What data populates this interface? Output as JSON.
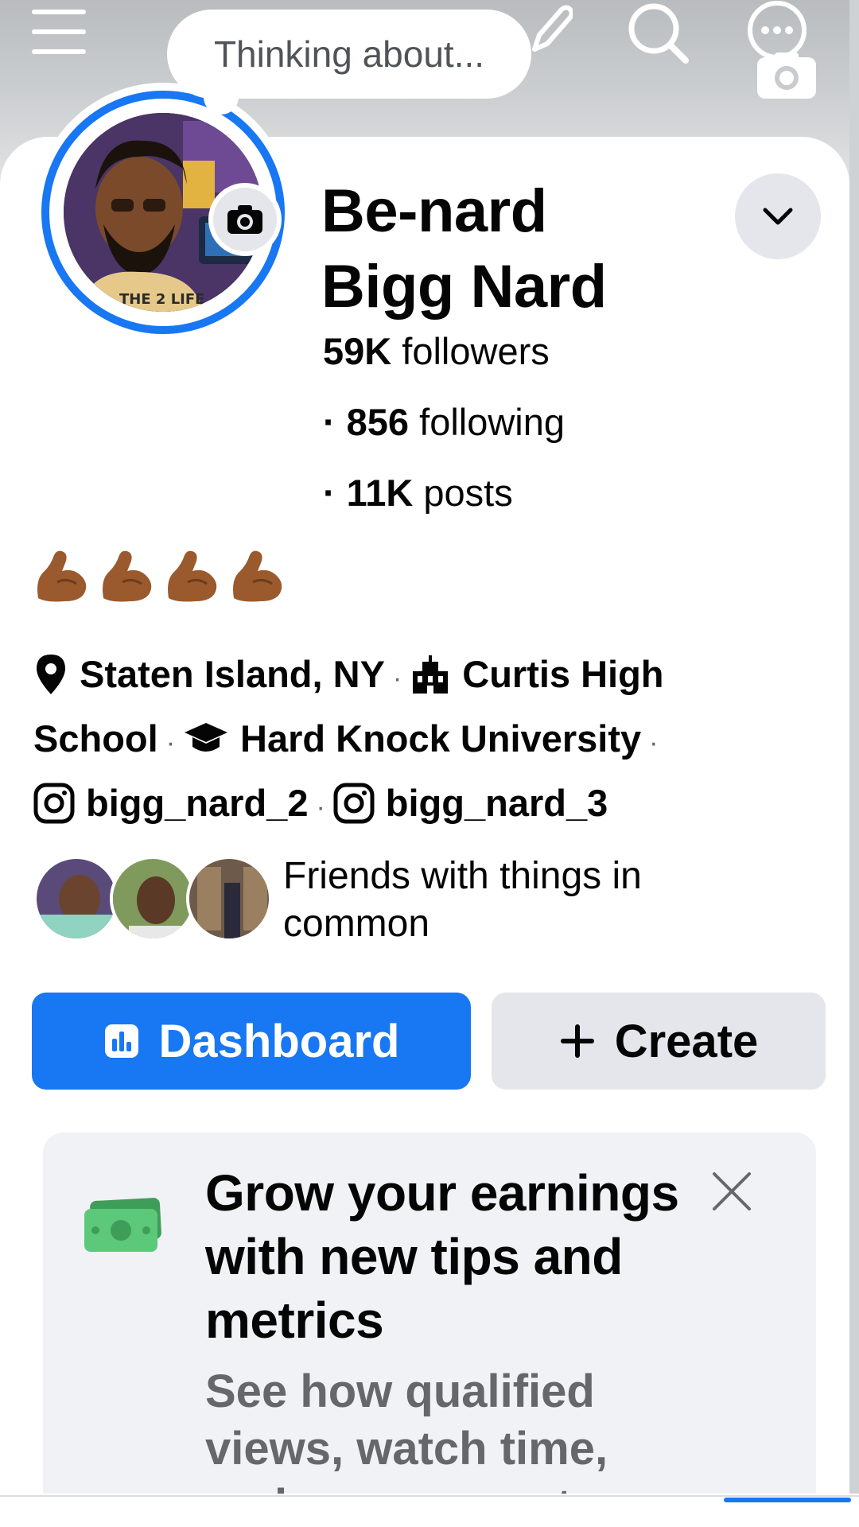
{
  "composer": {
    "prompt": "Thinking about..."
  },
  "profile": {
    "name_line1": "Be-nard",
    "name_line2": "Bigg Nard",
    "stats": [
      {
        "value": "59K",
        "label": "followers"
      },
      {
        "value": "856",
        "label": "following"
      },
      {
        "value": "11K",
        "label": "posts"
      }
    ],
    "bio_emoji": "💪🏾💪🏾💪🏾💪🏾",
    "details": {
      "location": "Staten Island, NY",
      "high_school": "Curtis High School",
      "school_line1": "Curtis High",
      "school_line2": "School",
      "university": "Hard Knock University",
      "instagram_1": "bigg_nard_2",
      "instagram_2": "bigg_nard_3"
    },
    "friends_text": "Friends with things in common"
  },
  "actions": {
    "dashboard_label": "Dashboard",
    "create_label": "Create"
  },
  "promo_card": {
    "title": "Grow your earnings with new tips and metrics",
    "subtitle": "See how qualified views, watch time, and engagement"
  },
  "colors": {
    "accent": "#1877f2",
    "secondary_button": "#e4e6eb",
    "card_bg": "#f0f2f5",
    "muted_text": "#65676b"
  },
  "icons": [
    "menu-icon",
    "pencil-icon",
    "search-icon",
    "messages-icon",
    "camera-icon",
    "chevron-down-icon",
    "location-pin-icon",
    "school-building-icon",
    "graduation-cap-icon",
    "instagram-icon",
    "dashboard-bars-icon",
    "plus-icon",
    "money-icon",
    "close-icon"
  ]
}
